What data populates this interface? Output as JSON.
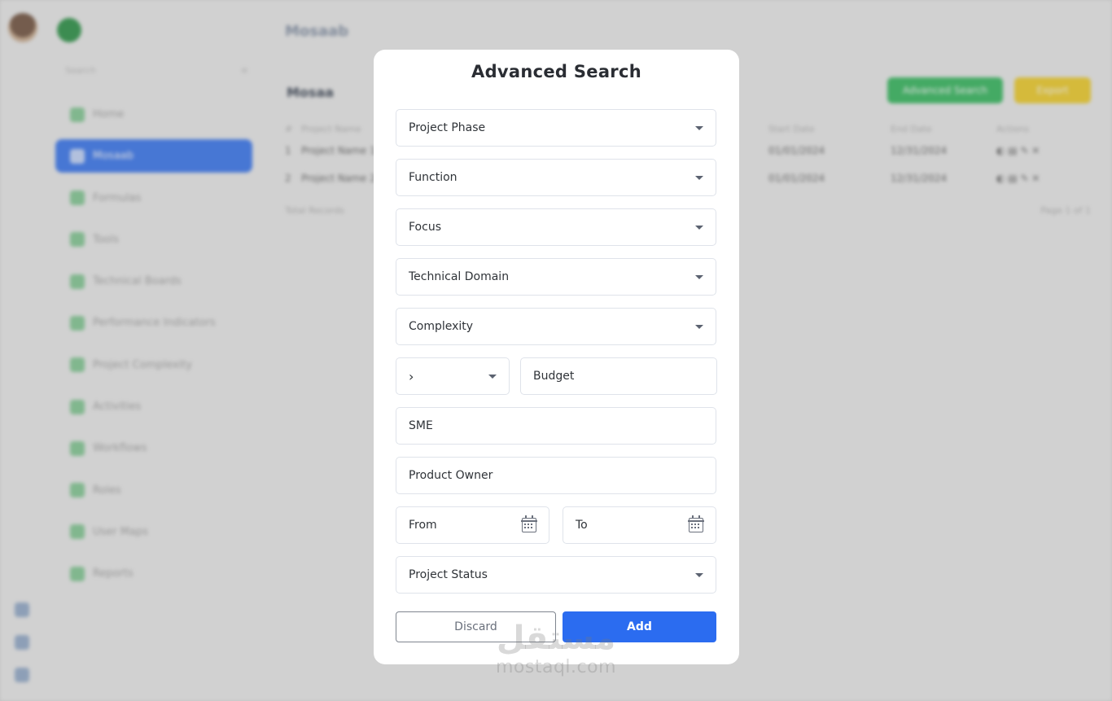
{
  "background": {
    "logo_text": "",
    "sidebar_search_placeholder": "Search",
    "menu": [
      {
        "label": "Home",
        "active": false
      },
      {
        "label": "Mosaab",
        "active": true
      },
      {
        "label": "Formulas",
        "active": false
      },
      {
        "label": "Tools",
        "active": false
      },
      {
        "label": "Technical Boards",
        "active": false
      },
      {
        "label": "Performance Indicators",
        "active": false
      },
      {
        "label": "Project Complexity",
        "active": false
      },
      {
        "label": "Activities",
        "active": false
      },
      {
        "label": "Workflows",
        "active": false
      },
      {
        "label": "Roles",
        "active": false
      },
      {
        "label": "User Maps",
        "active": false
      },
      {
        "label": "Reports",
        "active": false
      }
    ],
    "page_title": "Mosaab",
    "section_title": "Mosaa",
    "green_button": "Advanced Search",
    "yellow_button": "Export",
    "table": {
      "headers": [
        "#",
        "Project Name",
        "Start Date",
        "End Date",
        "Actions"
      ],
      "rows": [
        [
          "1",
          "Project Name 1",
          "01/01/2024",
          "12/31/2024",
          ""
        ],
        [
          "2",
          "Project Name 2",
          "01/01/2024",
          "12/31/2024",
          ""
        ]
      ]
    },
    "footer_left": "Total Records",
    "footer_right": "Page 1 of 1"
  },
  "modal": {
    "title": "Advanced Search",
    "fields": {
      "project_phase": "Project Phase",
      "function": "Function",
      "focus": "Focus",
      "technical_domain": "Technical Domain",
      "complexity": "Complexity",
      "budget_operator": "›",
      "budget": "Budget",
      "sme": "SME",
      "product_owner": "Product Owner",
      "from": "From",
      "to": "To",
      "project_status": "Project Status"
    },
    "discard_label": "Discard",
    "add_label": "Add"
  },
  "watermark": {
    "arabic": "مستقل",
    "latin": "mostaql.com"
  },
  "colors": {
    "primary": "#2b6cf0",
    "sidebar_active": "#2d6ff0",
    "green": "#29b655",
    "yellow": "#f1cc1c"
  }
}
